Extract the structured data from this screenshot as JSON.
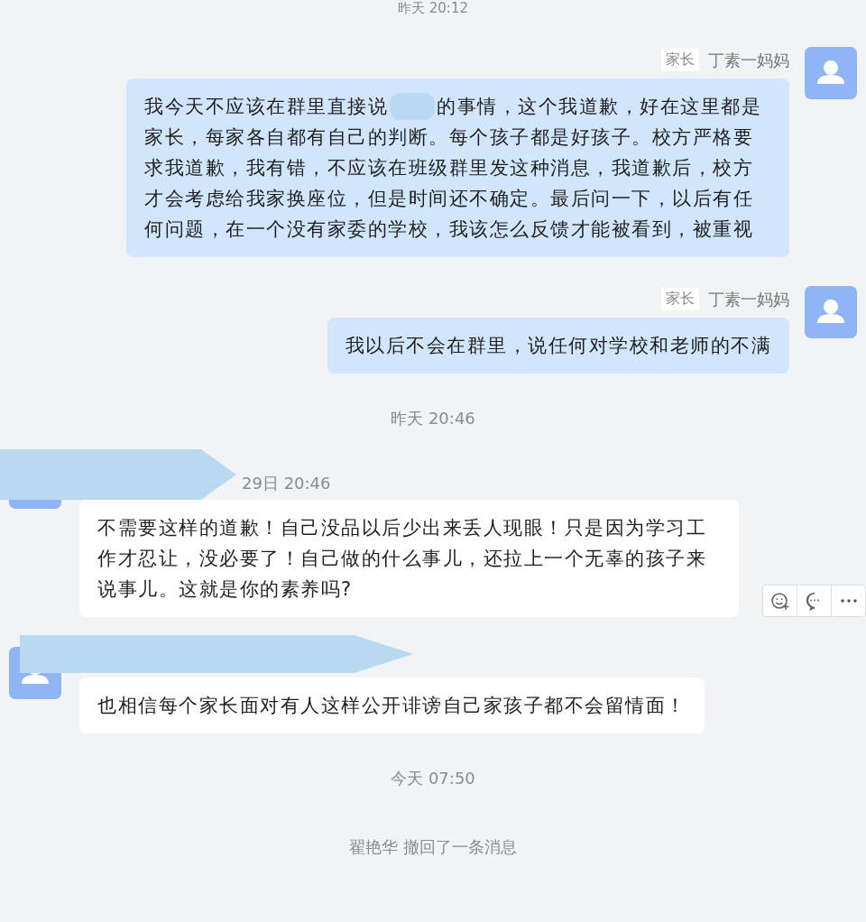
{
  "messages": [
    {
      "kind": "time",
      "text": "昨天 20:12"
    },
    {
      "kind": "sent",
      "tag": "家长",
      "sender": "丁素一妈妈",
      "text_before_redaction": "我今天不应该在群里直接说",
      "text_after_redaction": "的事情，这个我道歉，好在这里都是家长，每家各自都有自己的判断。每个孩子都是好孩子。校方严格要求我道歉，我有错，不应该在班级群里发这种消息，我道歉后，校方才会考虑给我家换座位，但是时间还不确定。最后问一下，以后有任何问题，在一个没有家委的学校，我该怎么反馈才能被看到，被重视"
    },
    {
      "kind": "sent",
      "tag": "家长",
      "sender": "丁素一妈妈",
      "text": "我以后不会在群里，说任何对学校和老师的不满"
    },
    {
      "kind": "time",
      "text": "昨天 20:46"
    },
    {
      "kind": "received",
      "header": "29日 20:46",
      "text": "不需要这样的道歉！自己没品以后少出来丢人现眼！只是因为学习工作才忍让，没必要了！自己做的什么事儿，还拉上一个无辜的孩子来说事儿。这就是你的素养吗?",
      "toolbar": true
    },
    {
      "kind": "received",
      "text": "也相信每个家长面对有人这样公开诽谤自己家孩子都不会留情面！",
      "toolbar": false
    },
    {
      "kind": "time",
      "text": "今天 07:50"
    },
    {
      "kind": "notice",
      "text": "翟艳华 撤回了一条消息"
    }
  ]
}
